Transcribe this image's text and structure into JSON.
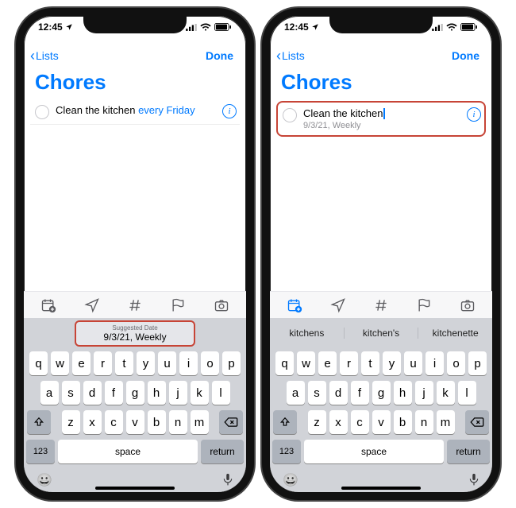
{
  "status": {
    "time": "12:45",
    "locationArrow": "➤"
  },
  "nav": {
    "backChevron": "‹",
    "backLabel": "Lists",
    "done": "Done"
  },
  "title": "Chores",
  "left": {
    "reminder": {
      "text": "Clean the kitchen ",
      "linkText": "every Friday"
    },
    "suggestion": {
      "label": "Suggested Date",
      "value": "9/3/21, Weekly"
    }
  },
  "right": {
    "reminder": {
      "text": "Clean the kitchen",
      "subtitle": "9/3/21, Weekly"
    },
    "completions": [
      "kitchens",
      "kitchen's",
      "kitchenette"
    ]
  },
  "toolbar": {
    "icons": [
      "calendar-add",
      "location-arrow",
      "hashtag",
      "flag",
      "camera"
    ]
  },
  "keyboard": {
    "rows": [
      [
        "q",
        "w",
        "e",
        "r",
        "t",
        "y",
        "u",
        "i",
        "o",
        "p"
      ],
      [
        "a",
        "s",
        "d",
        "f",
        "g",
        "h",
        "j",
        "k",
        "l"
      ],
      [
        "z",
        "x",
        "c",
        "v",
        "b",
        "n",
        "m"
      ]
    ],
    "n123": "123",
    "space": "space",
    "return": "return",
    "emoji": "😀"
  }
}
